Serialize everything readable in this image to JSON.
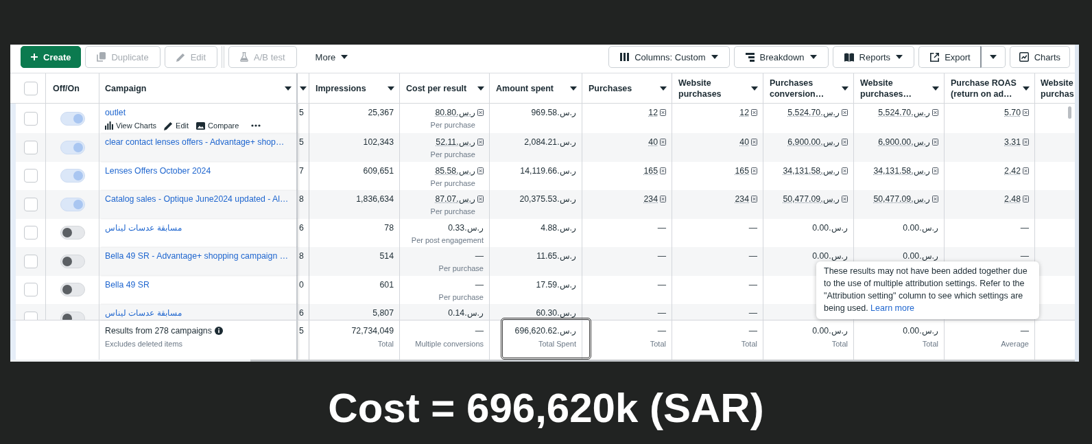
{
  "toolbar": {
    "left": [
      {
        "kind": "create",
        "label": "Create",
        "disabled": false,
        "dropdown": false,
        "split": false
      },
      {
        "kind": "duplicate",
        "label": "Duplicate",
        "disabled": true,
        "dropdown": false,
        "split": false
      },
      {
        "kind": "edit",
        "label": "Edit",
        "disabled": true,
        "dropdown": false,
        "split": false
      },
      {
        "kind": "divider"
      },
      {
        "kind": "ab_test",
        "label": "A/B test",
        "disabled": true,
        "dropdown": false,
        "split": false
      },
      {
        "kind": "more",
        "label": "More",
        "disabled": false,
        "dropdown": true,
        "split": false
      }
    ],
    "right": [
      {
        "kind": "columns",
        "label": "Columns: Custom",
        "disabled": false,
        "dropdown": true,
        "split": false
      },
      {
        "kind": "breakdown",
        "label": "Breakdown",
        "disabled": false,
        "dropdown": true,
        "split": false
      },
      {
        "kind": "reports",
        "label": "Reports",
        "disabled": false,
        "dropdown": true,
        "split": false
      },
      {
        "kind": "export",
        "label": "Export",
        "disabled": false,
        "dropdown": false,
        "split": true
      },
      {
        "kind": "charts",
        "label": "Charts",
        "disabled": false,
        "dropdown": false,
        "split": false
      }
    ]
  },
  "table": {
    "select_all": {
      "checked": false
    },
    "fixed_columns": [
      {
        "kind": "toggle",
        "label": "Off/On",
        "dropdown": false
      },
      {
        "kind": "name",
        "label": "Campaign",
        "dropdown": true
      }
    ],
    "column_3": {
      "dropdown": true
    },
    "columns": [
      {
        "label": "Impressions",
        "dropdown": true
      },
      {
        "label": "Cost per result",
        "dropdown": true
      },
      {
        "label": "Amount spent",
        "dropdown": true
      },
      {
        "label": "Purchases",
        "dropdown": true
      },
      {
        "label": "Website purchases",
        "dropdown": true
      },
      {
        "label": "Purchases conversion…",
        "dropdown": true
      },
      {
        "label": "Website purchases…",
        "dropdown": true
      },
      {
        "label": "Purchase ROAS (return on ad…",
        "dropdown": true
      },
      {
        "label": "Website purchas",
        "dropdown": false
      }
    ],
    "rows": [
      {
        "checked": false,
        "on": true,
        "name": "outlet",
        "actions": [
          {
            "kind": "charts",
            "label": "View Charts"
          },
          {
            "kind": "edit",
            "label": "Edit"
          },
          {
            "kind": "compare",
            "label": "Compare"
          },
          {
            "kind": "more"
          }
        ],
        "column_3": "5",
        "cells": [
          {
            "text": "25,367",
            "icon": false
          },
          {
            "text": "ر.س.80.80",
            "icon": true,
            "note": "Per purchase"
          },
          {
            "text": "ر.س.969.58",
            "icon": false
          },
          {
            "text": "12",
            "icon": true
          },
          {
            "text": "12",
            "icon": true
          },
          {
            "text": "ر.س.5,524.70",
            "icon": true
          },
          {
            "text": "ر.س.5,524.70",
            "icon": true
          },
          {
            "text": "5.70",
            "icon": true
          }
        ]
      },
      {
        "checked": false,
        "on": true,
        "name": "clear contact lenses offers - Advantage+ shop…",
        "column_3": "5",
        "cells": [
          {
            "text": "102,343",
            "icon": false
          },
          {
            "text": "ر.س.52.11",
            "icon": true,
            "note": "Per purchase"
          },
          {
            "text": "ر.س.2,084.21",
            "icon": false
          },
          {
            "text": "40",
            "icon": true
          },
          {
            "text": "40",
            "icon": true
          },
          {
            "text": "ر.س.6,900.00",
            "icon": true
          },
          {
            "text": "ر.س.6,900.00",
            "icon": true
          },
          {
            "text": "3.31",
            "icon": true
          }
        ]
      },
      {
        "checked": false,
        "on": true,
        "name": "Lenses Offers October 2024",
        "column_3": "7",
        "cells": [
          {
            "text": "609,651",
            "icon": false
          },
          {
            "text": "ر.س.85.58",
            "icon": true,
            "note": "Per purchase"
          },
          {
            "text": "ر.س.14,119.66",
            "icon": false
          },
          {
            "text": "165",
            "icon": true
          },
          {
            "text": "165",
            "icon": true
          },
          {
            "text": "ر.س.34,131.58",
            "icon": true
          },
          {
            "text": "ر.س.34,131.58",
            "icon": true
          },
          {
            "text": "2.42",
            "icon": true
          }
        ]
      },
      {
        "checked": false,
        "on": true,
        "name": "Catalog sales - Optique June2024 updated - Al…",
        "column_3": "8",
        "cells": [
          {
            "text": "1,836,634",
            "icon": false
          },
          {
            "text": "ر.س.87.07",
            "icon": true,
            "note": "Per purchase"
          },
          {
            "text": "ر.س.20,375.53",
            "icon": false
          },
          {
            "text": "234",
            "icon": true
          },
          {
            "text": "234",
            "icon": true
          },
          {
            "text": "ر.س.50,477.09",
            "icon": true
          },
          {
            "text": "ر.س.50,477.09",
            "icon": true
          },
          {
            "text": "2.48",
            "icon": true
          }
        ]
      },
      {
        "checked": false,
        "on": false,
        "name": "مسابقة عدسات ليناس",
        "column_3": "6",
        "cells": [
          {
            "text": "78",
            "icon": false
          },
          {
            "text": "ر.س.0.33",
            "icon": false,
            "note": "Per post engagement"
          },
          {
            "text": "ر.س.4.88",
            "icon": false
          },
          {
            "text": "—",
            "icon": false
          },
          {
            "text": "—",
            "icon": false
          },
          {
            "text": "ر.س.0.00",
            "icon": false
          },
          {
            "text": "ر.س.0.00",
            "icon": false
          },
          {
            "text": "—",
            "icon": false
          }
        ]
      },
      {
        "checked": false,
        "on": false,
        "name": "Bella 49 SR - Advantage+ shopping campaign …",
        "column_3": "8",
        "cells": [
          {
            "text": "514",
            "icon": false
          },
          {
            "text": "—",
            "icon": false,
            "note": "Per purchase"
          },
          {
            "text": "ر.س.11.65",
            "icon": false
          },
          {
            "text": "—",
            "icon": false
          },
          {
            "text": "—",
            "icon": false
          },
          {
            "text": "ر.س.0.00",
            "icon": false
          },
          {
            "text": "ر.س.0.00",
            "icon": false
          },
          {
            "text": "—",
            "icon": false
          }
        ]
      },
      {
        "checked": false,
        "on": false,
        "name": "Bella 49 SR",
        "column_3": "0",
        "cells": [
          {
            "text": "601",
            "icon": false
          },
          {
            "text": "—",
            "icon": false,
            "note": "Per purchase"
          },
          {
            "text": "ر.س.17.59",
            "icon": false
          },
          {
            "text": "—",
            "icon": false
          },
          {
            "text": "—",
            "icon": false
          }
        ]
      },
      {
        "checked": false,
        "on": false,
        "name": "مسابقة عدسات ليناس",
        "column_3": "6",
        "cells": [
          {
            "text": "5,807",
            "icon": false
          },
          {
            "text": "ر.س.0.14",
            "icon": false
          },
          {
            "text": "ر.س.60.30",
            "icon": false
          },
          {
            "text": "—",
            "icon": false
          },
          {
            "text": "—",
            "icon": false
          }
        ]
      }
    ],
    "footer": {
      "title": "Results from 278 campaigns",
      "note": "Excludes deleted items",
      "column_3": "5",
      "cells": [
        {
          "text": "72,734,049",
          "note": "Total",
          "highlighted": false
        },
        {
          "text": "—",
          "note": "Multiple conversions",
          "highlighted": false
        },
        {
          "text": "ر.س.696,620.62",
          "note": "Total Spent",
          "highlighted": true
        },
        {
          "text": "—",
          "note": "Total",
          "highlighted": false
        },
        {
          "text": "—",
          "note": "Total",
          "highlighted": false
        },
        {
          "text": "ر.س.0.00",
          "note": "Total",
          "highlighted": false
        },
        {
          "text": "ر.س.0.00",
          "note": "Total",
          "highlighted": false
        },
        {
          "text": "—",
          "note": "Average",
          "highlighted": false
        }
      ]
    },
    "tooltip": {
      "text": "These results may not have been added together due to the use of multiple attribution settings. Refer to the \"Attribution setting\" column to see which settings are being used.",
      "link": "Learn more"
    }
  },
  "caption": {
    "text": "Cost = 696,620k (SAR)"
  }
}
